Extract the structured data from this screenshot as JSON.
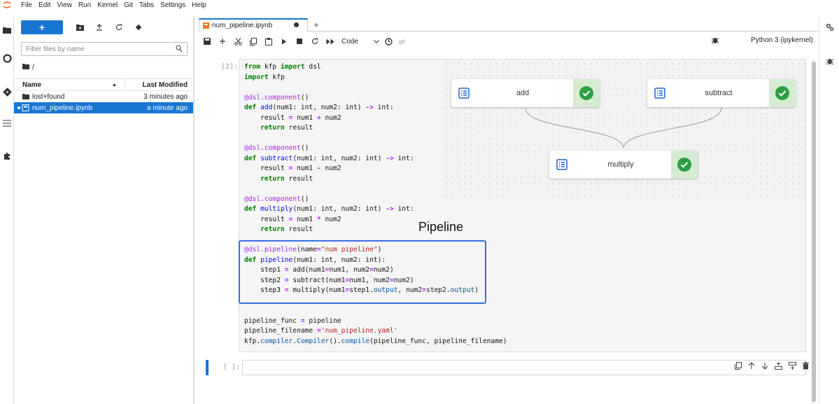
{
  "menu": [
    "File",
    "Edit",
    "View",
    "Run",
    "Kernel",
    "Git",
    "Tabs",
    "Settings",
    "Help"
  ],
  "filebrowser": {
    "new_label": "+",
    "filter_placeholder": "Filter files by name",
    "path": "/",
    "col_name": "Name",
    "col_modified": "Last Modified",
    "files": [
      {
        "name": "lost+found",
        "modified": "3 minutes ago",
        "kind": "folder"
      },
      {
        "name": "num_pipeline.ipynb",
        "modified": "a minute ago",
        "kind": "notebook"
      }
    ]
  },
  "notebook": {
    "tab_title": "num_pipeline.ipynb",
    "cell_type": "Code",
    "git_label": "git",
    "kernel": "Python 3 (ipykernel)",
    "cell_prompt": "[2]:",
    "empty_prompt": "[ ]:"
  },
  "diagram": {
    "nodes": [
      {
        "label": "add"
      },
      {
        "label": "subtract"
      },
      {
        "label": "multiply"
      }
    ]
  },
  "annotation": {
    "pipeline_label": "Pipeline"
  },
  "colors": {
    "accent": "#1976d2",
    "highlight_border": "#3a6fe0",
    "success": "#2e9e45"
  }
}
